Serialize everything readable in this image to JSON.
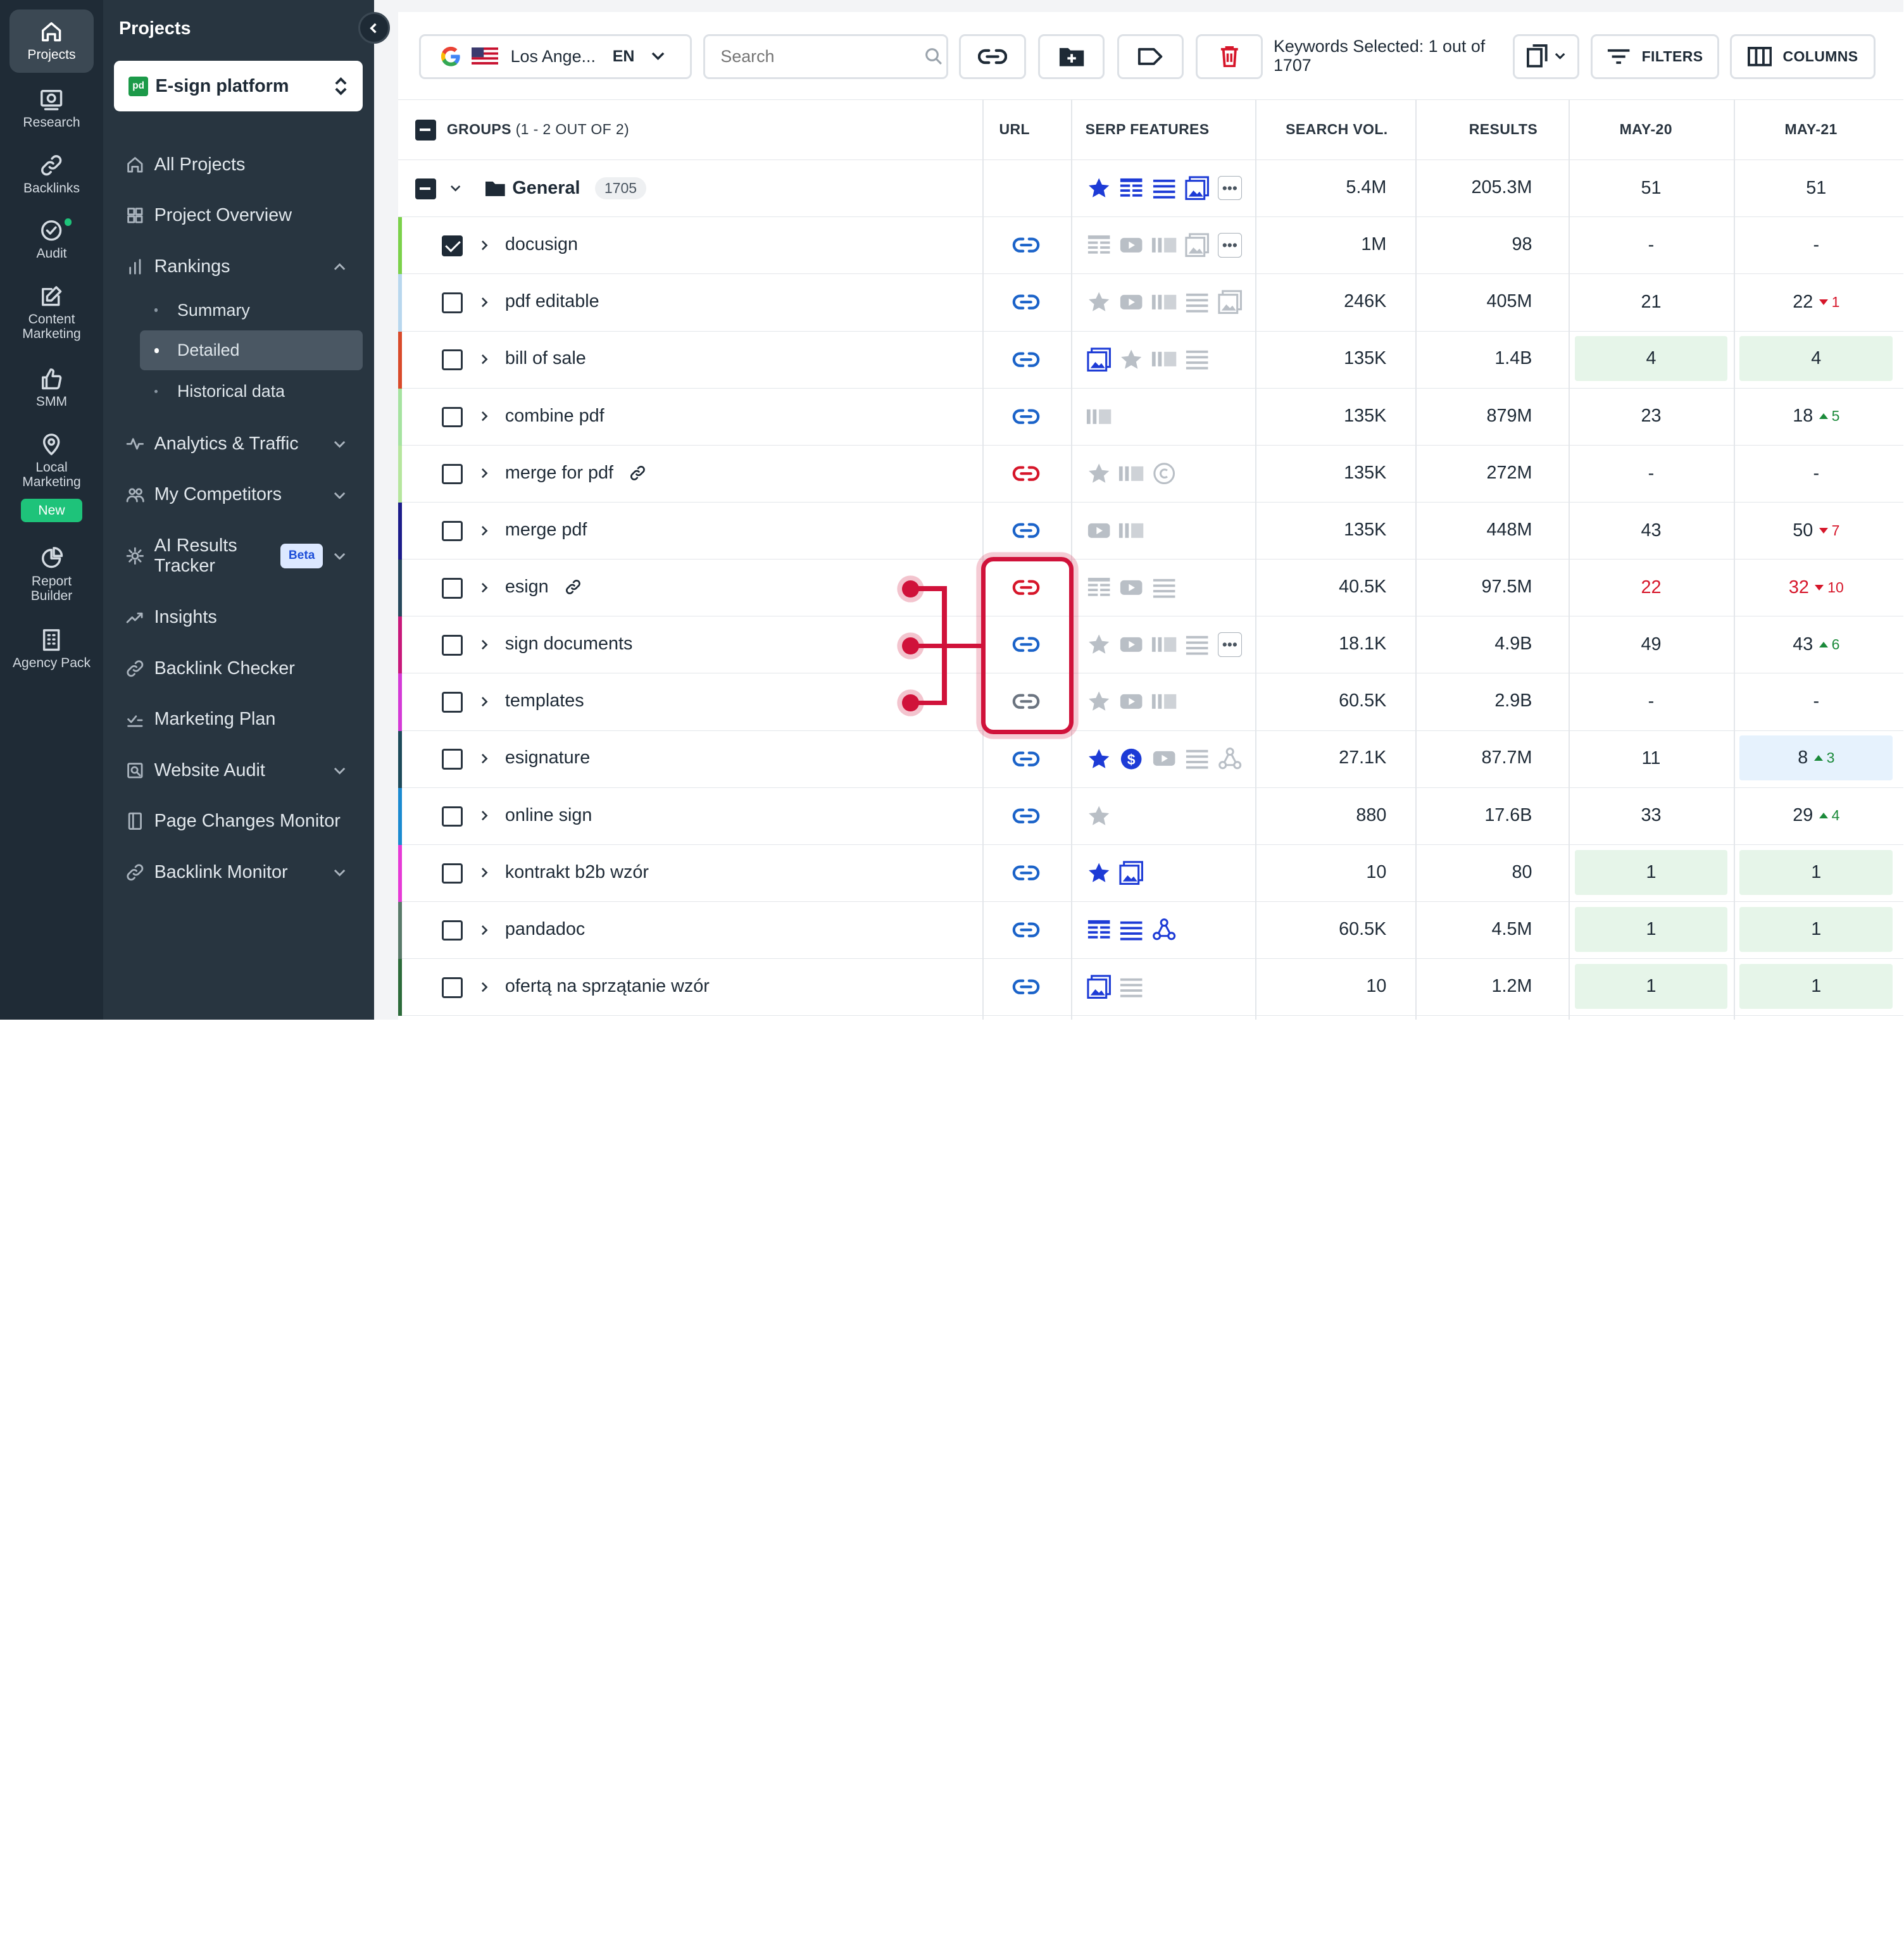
{
  "rail": {
    "items": [
      {
        "label": "Projects",
        "icon": "home-icon",
        "active": true
      },
      {
        "label": "Research",
        "icon": "research-icon"
      },
      {
        "label": "Backlinks",
        "icon": "link-icon"
      },
      {
        "label": "Audit",
        "icon": "check-circle-icon"
      },
      {
        "label": "Content Marketing",
        "icon": "edit-icon"
      },
      {
        "label": "SMM",
        "icon": "thumbs-up-icon"
      },
      {
        "label": "Local Marketing",
        "icon": "map-pin-icon"
      },
      {
        "label": "Report Builder",
        "icon": "pie-chart-icon"
      },
      {
        "label": "Agency Pack",
        "icon": "building-icon"
      }
    ],
    "new_badge": "New"
  },
  "sidebar": {
    "title": "Projects",
    "project": "E-sign platform",
    "project_favicon": "pd",
    "nav": [
      {
        "label": "All Projects",
        "icon": "home-icon"
      },
      {
        "label": "Project Overview",
        "icon": "grid-icon"
      },
      {
        "label": "Rankings",
        "icon": "bar-chart-icon"
      }
    ],
    "subnav": [
      {
        "label": "Summary"
      },
      {
        "label": "Detailed",
        "active": true
      },
      {
        "label": "Historical data"
      }
    ],
    "nav2": [
      {
        "label": "Analytics & Traffic",
        "icon": "activity-icon"
      },
      {
        "label": "My Competitors",
        "icon": "users-icon"
      },
      {
        "label": "AI Results Tracker",
        "icon": "ai-icon"
      },
      {
        "label": "Insights",
        "icon": "trend-icon"
      },
      {
        "label": "Backlink Checker",
        "icon": "link-icon"
      },
      {
        "label": "Marketing Plan",
        "icon": "checklist-icon"
      },
      {
        "label": "Website Audit",
        "icon": "audit-icon"
      },
      {
        "label": "Page Changes Monitor",
        "icon": "page-icon"
      },
      {
        "label": "Backlink Monitor",
        "icon": "link-icon"
      }
    ],
    "beta": "Beta"
  },
  "toolbar": {
    "location": "Los Ange...",
    "language": "EN",
    "search_placeholder": "Search",
    "selected_text": "Keywords Selected: 1 out of 1707",
    "filters": "FILTERS",
    "columns": "COLUMNS"
  },
  "table": {
    "headers": {
      "groups": "GROUPS",
      "groups_count": "(1 - 2 OUT OF 2)",
      "url": "URL",
      "serp": "SERP FEATURES",
      "vol": "SEARCH VOL.",
      "results": "RESULTS",
      "d1": "MAY-20",
      "d2": "MAY-21"
    },
    "group": {
      "name": "General",
      "count": "1705",
      "vol": "5.4M",
      "results": "205.3M",
      "d1": "51",
      "d2": "51"
    },
    "rows": [
      {
        "kw": "docusign",
        "vol": "1M",
        "results": "98",
        "d1": "-",
        "d2": "-",
        "stripe": "#7bd14a",
        "checked": true,
        "url": "blue",
        "serp": [
          "snippet",
          "video",
          "carousel",
          "image",
          "more"
        ],
        "serp_active": []
      },
      {
        "kw": "pdf editable",
        "vol": "246K",
        "results": "405M",
        "d1": "21",
        "d2": "22",
        "chg": "1",
        "dir": "dn",
        "stripe": "#b8d7ee",
        "url": "blue",
        "serp": [
          "star",
          "video",
          "carousel",
          "list",
          "image"
        ],
        "serp_active": []
      },
      {
        "kw": "bill of sale",
        "vol": "135K",
        "results": "1.4B",
        "d1": "4",
        "d2": "4",
        "bg": "green",
        "stripe": "#d94a2a",
        "url": "blue",
        "serp": [
          "image",
          "star",
          "carousel",
          "list"
        ],
        "serp_active": [
          "image"
        ]
      },
      {
        "kw": "combine pdf",
        "vol": "135K",
        "results": "879M",
        "d1": "23",
        "d2": "18",
        "chg": "5",
        "dir": "up",
        "stripe": "#a5e3a0",
        "url": "blue",
        "serp": [
          "carousel"
        ],
        "serp_active": []
      },
      {
        "kw": "merge for pdf",
        "vol": "135K",
        "results": "272M",
        "d1": "-",
        "d2": "-",
        "stripe": "#b6e69e",
        "url": "red",
        "link": true,
        "serp": [
          "star",
          "carousel",
          "copyright"
        ],
        "serp_active": []
      },
      {
        "kw": "merge pdf",
        "vol": "135K",
        "results": "448M",
        "d1": "43",
        "d2": "50",
        "chg": "7",
        "dir": "dn",
        "stripe": "#1c1c8a",
        "url": "blue",
        "serp": [
          "video",
          "carousel"
        ],
        "serp_active": []
      },
      {
        "kw": "esign",
        "vol": "40.5K",
        "results": "97.5M",
        "d1": "22",
        "d2": "32",
        "chg": "10",
        "dir": "dn",
        "red": true,
        "stripe": "#27485c",
        "url": "red",
        "link": true,
        "serp": [
          "snippet",
          "video",
          "list"
        ],
        "serp_active": []
      },
      {
        "kw": "sign documents",
        "vol": "18.1K",
        "results": "4.9B",
        "d1": "49",
        "d2": "43",
        "chg": "6",
        "dir": "up",
        "stripe": "#c8187a",
        "url": "blue",
        "serp": [
          "star",
          "video",
          "carousel",
          "list",
          "more"
        ],
        "serp_active": []
      },
      {
        "kw": "templates",
        "vol": "60.5K",
        "results": "2.9B",
        "d1": "-",
        "d2": "-",
        "stripe": "#d43ad6",
        "url": "grey",
        "serp": [
          "star",
          "video",
          "carousel"
        ],
        "serp_active": []
      },
      {
        "kw": "esignature",
        "vol": "27.1K",
        "results": "87.7M",
        "d1": "11",
        "d2": "8",
        "chg": "3",
        "dir": "up",
        "bg2": "blue",
        "stripe": "#1d4a5a",
        "url": "blue",
        "serp": [
          "star",
          "dollar",
          "video",
          "list",
          "graph"
        ],
        "serp_active": [
          "star",
          "dollar"
        ]
      },
      {
        "kw": "online sign",
        "vol": "880",
        "results": "17.6B",
        "d1": "33",
        "d2": "29",
        "chg": "4",
        "dir": "up",
        "stripe": "#1b8ad0",
        "url": "blue",
        "serp": [
          "star"
        ],
        "serp_active": []
      },
      {
        "kw": "kontrakt b2b wzór",
        "vol": "10",
        "results": "80",
        "d1": "1",
        "d2": "1",
        "bg": "green",
        "stripe": "#e63ad6",
        "url": "blue",
        "serp": [
          "star",
          "image"
        ],
        "serp_active": [
          "star",
          "image"
        ]
      },
      {
        "kw": "pandadoc",
        "vol": "60.5K",
        "results": "4.5M",
        "d1": "1",
        "d2": "1",
        "bg": "green",
        "stripe": "#5a7a6a",
        "url": "blue",
        "serp": [
          "snippet",
          "list",
          "graph"
        ],
        "serp_active": [
          "snippet",
          "list",
          "graph"
        ]
      },
      {
        "kw": "ofertą na sprzątanie wzór",
        "vol": "10",
        "results": "1.2M",
        "d1": "1",
        "d2": "1",
        "bg": "green",
        "stripe": "#2c6b3a",
        "url": "blue",
        "serp": [
          "image",
          "list"
        ],
        "serp_active": [
          "image"
        ]
      }
    ]
  },
  "colors": {
    "accent": "#1d4ed8",
    "highlight": "#d0123a",
    "rail": "#1f2b36",
    "sidebar": "#283540"
  }
}
